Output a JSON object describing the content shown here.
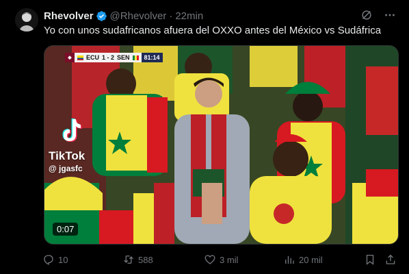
{
  "author": {
    "display_name": "Rhevolver",
    "handle": "@Rhevolver",
    "separator": "·",
    "time": "22min",
    "verified_icon": "verified-badge-icon"
  },
  "tweet": {
    "text": "Yo con unos sudafricanos afuera del OXXO antes del México vs Sudáfrica"
  },
  "video": {
    "scorebug": {
      "team_home": "ECU",
      "score": "1 - 2",
      "team_away": "SEN",
      "clock": "81:14"
    },
    "watermark": {
      "brand": "TikTok",
      "user": "@ jgasfc"
    },
    "duration": "0:07"
  },
  "actions": {
    "replies": "10",
    "reposts": "588",
    "likes": "3 mil",
    "views": "20 mil"
  },
  "colors": {
    "background": "#000000",
    "text": "#e7e9ea",
    "muted": "#71767b",
    "verified": "#1d9bf0",
    "senegal_green": "#00853f",
    "senegal_yellow": "#fdef42",
    "senegal_red": "#e31b23"
  }
}
